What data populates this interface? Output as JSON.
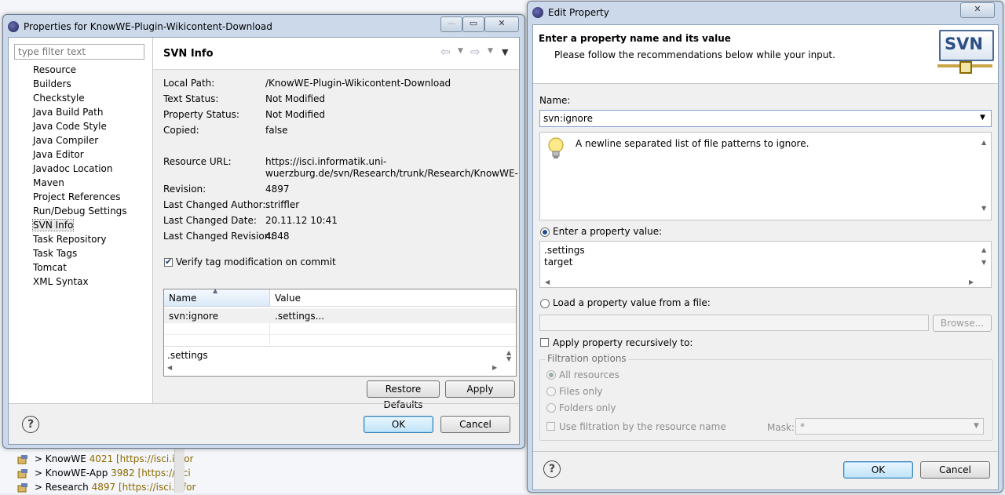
{
  "background_ide": {
    "tree": [
      {
        "name": "KnowWE",
        "revision": "4021",
        "url": "[https://isci.infor"
      },
      {
        "name": "KnowWE-App",
        "revision": "3982",
        "url": "[https://isci"
      },
      {
        "name": "Research",
        "revision": "4897",
        "url": "[https://isci.infor"
      }
    ],
    "prefix": ">"
  },
  "properties_dialog": {
    "title": "Properties for KnowWE-Plugin-Wikicontent-Download",
    "filter_placeholder": "type filter text",
    "nav_items": [
      "Resource",
      "Builders",
      "Checkstyle",
      "Java Build Path",
      "Java Code Style",
      "Java Compiler",
      "Java Editor",
      "Javadoc Location",
      "Maven",
      "Project References",
      "Run/Debug Settings",
      "SVN Info",
      "Task Repository",
      "Task Tags",
      "Tomcat",
      "XML Syntax"
    ],
    "selected_nav": "SVN Info",
    "page_title": "SVN Info",
    "info": [
      {
        "label": "Local Path:",
        "value": "/KnowWE-Plugin-Wikicontent-Download"
      },
      {
        "label": "Text Status:",
        "value": "Not Modified"
      },
      {
        "label": "Property Status:",
        "value": "Not Modified"
      },
      {
        "label": "Copied:",
        "value": "false"
      },
      {
        "label": "Resource URL:",
        "value": "https://isci.informatik.uni-",
        "value2": "wuerzburg.de/svn/Research/trunk/Research/KnowWE-"
      },
      {
        "label": "Revision:",
        "value": "4897"
      },
      {
        "label": "Last Changed Author:",
        "value": "striffler"
      },
      {
        "label": "Last Changed Date:",
        "value": "20.11.12 10:41"
      },
      {
        "label": "Last Changed Revision:",
        "value": "4848"
      }
    ],
    "verify_tag_label": "Verify tag modification on commit",
    "verify_tag_checked": true,
    "table": {
      "headers": [
        "Name",
        "Value"
      ],
      "rows": [
        [
          "svn:ignore",
          ".settings..."
        ]
      ]
    },
    "value_preview": ".settings",
    "restore_defaults_label": "Restore Defaults",
    "apply_label": "Apply",
    "ok_label": "OK",
    "cancel_label": "Cancel"
  },
  "edit_property_dialog": {
    "title": "Edit Property",
    "header_title": "Enter a property name and its value",
    "header_subtitle": "Please follow the recommendations below while your input.",
    "logo_text": "SVN",
    "name_label": "Name:",
    "name_value": "svn:ignore",
    "hint_text": "A newline separated list of file patterns to ignore.",
    "enter_value_label": "Enter a property value:",
    "value_lines": [
      ".settings",
      "target"
    ],
    "load_from_file_label": "Load a property value from a file:",
    "browse_label": "Browse...",
    "apply_recursive_label": "Apply property recursively to:",
    "filtration_title": "Filtration options",
    "filtration_options": [
      "All resources",
      "Files only",
      "Folders only"
    ],
    "use_filtration_label": "Use filtration by the resource name",
    "mask_label": "Mask:",
    "mask_value": "*",
    "ok_label": "OK",
    "cancel_label": "Cancel"
  }
}
